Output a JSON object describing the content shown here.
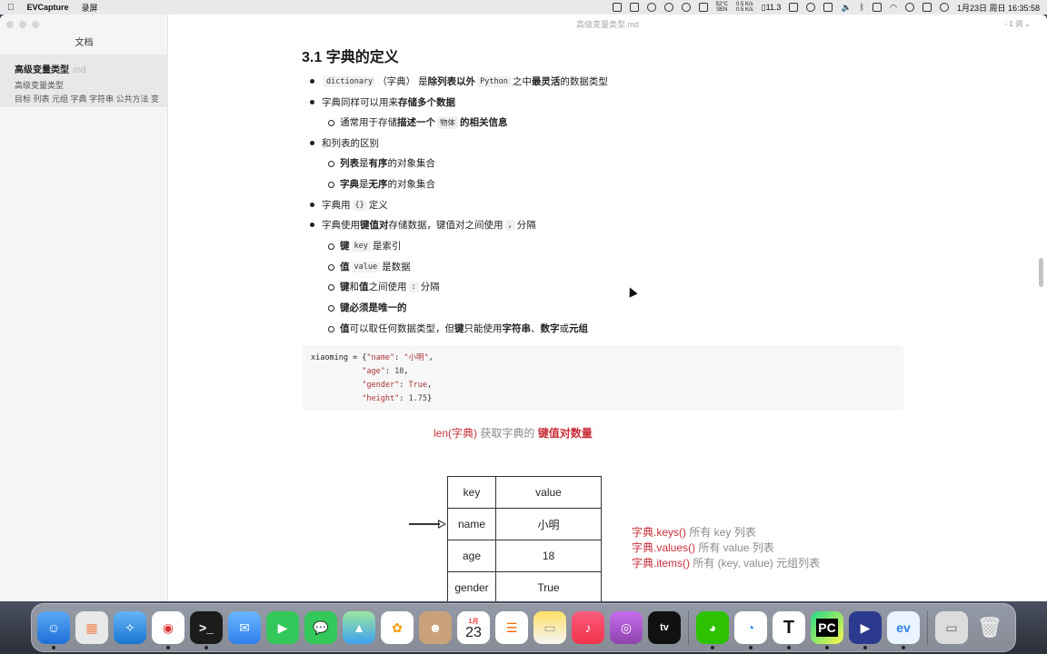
{
  "menubar": {
    "app_name": "EVCapture",
    "menu_record": "录屏",
    "temp": "52°C",
    "temp_sub": "SEN",
    "net_up": "0.5 K/s",
    "net_down": "0.5 K/s",
    "battery_pct": "11.3",
    "datetime": "1月23日 周日 16:35:58"
  },
  "window": {
    "doc_title": "高级变量类型.md",
    "word_count": "- 1 词 ⌄"
  },
  "sidebar": {
    "title": "文档",
    "items": [
      {
        "name": "高级变量类型",
        "ext": ".md",
        "preview_line1": "高级变量类型",
        "preview_line2": "目标 列表 元组 字典 字符串 公共方法 变"
      }
    ]
  },
  "doc": {
    "heading": "3.1 字典的定义",
    "b1": {
      "code1": "dictionary",
      "t1": "（字典） 是 ",
      "bold1": "除列表以外",
      "code2": "Python",
      "t2": " 之中 ",
      "bold2": "最灵活",
      "t3": " 的数据类型"
    },
    "b2": {
      "t1": "字典同样可以用来 ",
      "bold1": "存储多个数据"
    },
    "b2a": {
      "t1": "通常用于存储 ",
      "bold1": "描述一个 ",
      "code1": "物体",
      "bold2": " 的相关信息"
    },
    "b3": {
      "t1": "和列表的区别"
    },
    "b3a": {
      "bold1": "列表",
      "t1": " 是 ",
      "bold2": "有序",
      "t2": " 的对象集合"
    },
    "b3b": {
      "bold1": "字典",
      "t1": " 是 ",
      "bold2": "无序",
      "t2": " 的对象集合"
    },
    "b4": {
      "t1": "字典用 ",
      "code1": "{}",
      "t2": " 定义"
    },
    "b5": {
      "t1": "字典使用 ",
      "bold1": "键值对",
      "t2": " 存储数据，键值对之间使用 ",
      "code1": ",",
      "t3": " 分隔"
    },
    "b5a": {
      "bold1": "键",
      "code1": "key",
      "t1": " 是索引"
    },
    "b5b": {
      "bold1": "值",
      "code1": "value",
      "t1": " 是数据"
    },
    "b5c": {
      "bold1": "键",
      "t1": " 和 ",
      "bold2": "值",
      "t2": " 之间使用 ",
      "code1": ":",
      "t3": " 分隔"
    },
    "b5d": {
      "bold1": "键必须是唯一的"
    },
    "b5e": {
      "bold1": "值",
      "t1": " 可以取任何数据类型，但 ",
      "bold2": "键",
      "t2": " 只能使用 ",
      "bold3": "字符串",
      "t3": "、",
      "bold4": "数字",
      "t4": "或 ",
      "bold5": "元组"
    }
  },
  "code": {
    "l1_a": "xiaoming = {",
    "l1_k": "\"name\"",
    "l1_s": ": ",
    "l1_v": "\"小明\"",
    "l1_e": ",",
    "l2_pad": "           ",
    "l2_k": "\"age\"",
    "l2_s": ": ",
    "l2_v": "18",
    "l2_e": ",",
    "l3_pad": "           ",
    "l3_k": "\"gender\"",
    "l3_s": ": ",
    "l3_v": "True",
    "l3_e": ",",
    "l4_pad": "           ",
    "l4_k": "\"height\"",
    "l4_s": ": ",
    "l4_v": "1.75",
    "l4_e": "}"
  },
  "figure": {
    "caption_a": "len(字典)",
    "caption_b": " 获取字典的 ",
    "caption_c": "键值对数量",
    "table_header": {
      "key": "key",
      "value": "value"
    },
    "rows": [
      {
        "key": "name",
        "value": "小明"
      },
      {
        "key": "age",
        "value": "18"
      },
      {
        "key": "gender",
        "value": "True"
      }
    ],
    "m1_a": "字典.keys()",
    "m1_b": " 所有 key 列表",
    "m2_a": "字典.values()",
    "m2_b": " 所有 value 列表",
    "m3_a": "字典.items()",
    "m3_b": " 所有 (key, value) 元组列表"
  },
  "dock": {
    "calendar_month": "1月",
    "calendar_day": "23",
    "apps": [
      "finder-icon",
      "launchpad-icon",
      "safari-icon",
      "chrome-icon",
      "terminal-icon",
      "mail-icon",
      "facetime-icon",
      "messages-icon",
      "maps-icon",
      "photos-icon",
      "contacts-icon",
      "calendar-icon",
      "reminders-icon",
      "notes-icon",
      "music-icon",
      "podcasts-icon",
      "tv-icon",
      "wechat-icon",
      "qq-icon",
      "typora-icon",
      "pycharm-icon",
      "evcapture-icon",
      "ev-icon",
      "preview-icon",
      "trash-icon"
    ]
  }
}
